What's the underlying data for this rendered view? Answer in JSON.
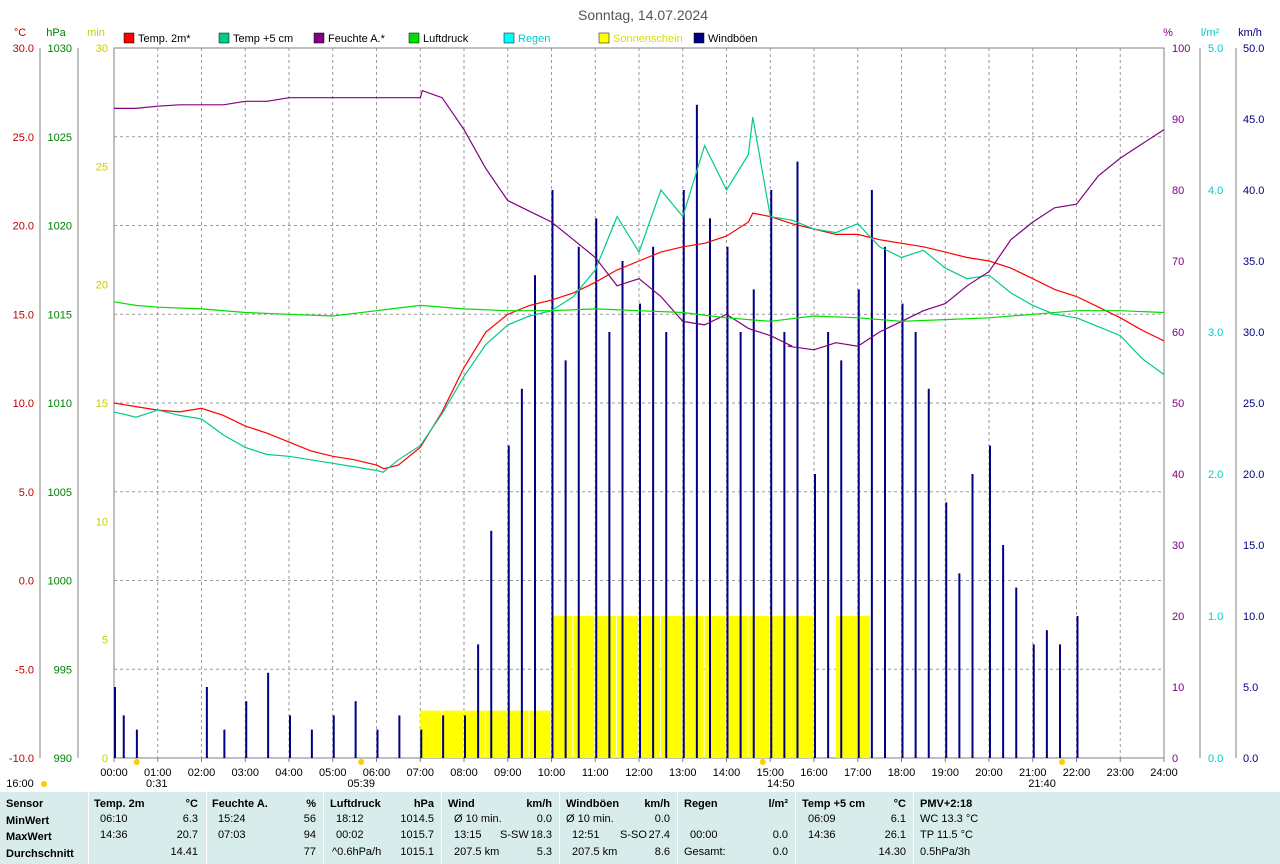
{
  "title": "Sonntag, 14.07.2024",
  "chart_data": {
    "type": "line",
    "title": "Sonntag, 14.07.2024",
    "x_axis": {
      "label": "",
      "range_hours": [
        0,
        24
      ],
      "tick_labels": [
        "00:00",
        "01:00",
        "02:00",
        "03:00",
        "04:00",
        "05:00",
        "06:00",
        "07:00",
        "08:00",
        "09:00",
        "10:00",
        "11:00",
        "12:00",
        "13:00",
        "14:00",
        "15:00",
        "16:00",
        "17:00",
        "18:00",
        "19:00",
        "20:00",
        "21:00",
        "22:00",
        "23:00",
        "24:00"
      ],
      "markers": [
        {
          "label": "0:31",
          "hour": 0.52
        },
        {
          "label": "05:39",
          "hour": 5.65
        },
        {
          "label": "14:50",
          "hour": 14.83
        },
        {
          "label": "21:40",
          "hour": 21.67
        },
        {
          "label": "16:00",
          "hour": 16.0
        }
      ]
    },
    "y_axes": [
      {
        "unit": "°C",
        "range": [
          -10,
          30
        ],
        "ticks": [
          "30.0",
          "25.0",
          "20.0",
          "15.0",
          "10.0",
          "5.0",
          "0.0",
          "-5.0",
          "-10.0"
        ],
        "color": "#c00000"
      },
      {
        "unit": "hPa",
        "range": [
          990,
          1030
        ],
        "ticks": [
          "1030",
          "1025",
          "1020",
          "1015",
          "1010",
          "1005",
          "1000",
          "995",
          "990"
        ],
        "color": "#008000"
      },
      {
        "unit": "min",
        "range": [
          0,
          30
        ],
        "ticks": [
          "30",
          "25",
          "20",
          "15",
          "10",
          "5",
          "0"
        ],
        "color": "#cccc00"
      },
      {
        "unit": "%",
        "range": [
          0,
          100
        ],
        "ticks": [
          "100",
          "90",
          "80",
          "70",
          "60",
          "50",
          "40",
          "30",
          "20",
          "10",
          "0"
        ],
        "color": "#800080"
      },
      {
        "unit": "l/m²",
        "range": [
          0,
          5
        ],
        "ticks": [
          "5.0",
          "4.0",
          "3.0",
          "2.0",
          "1.0",
          "0.0"
        ],
        "color": "#00cccc"
      },
      {
        "unit": "km/h",
        "range": [
          0,
          50
        ],
        "ticks": [
          "50.0",
          "45.0",
          "40.0",
          "35.0",
          "30.0",
          "25.0",
          "20.0",
          "15.0",
          "10.0",
          "5.0",
          "0.0"
        ],
        "color": "#000080"
      }
    ],
    "grid": true,
    "legend_position": "top",
    "legend": [
      {
        "name": "Temp. 2m*",
        "color": "#ff0000"
      },
      {
        "name": "Temp +5 cm",
        "color": "#00cc88"
      },
      {
        "name": "Feuchte A.*",
        "color": "#800080"
      },
      {
        "name": "Luftdruck",
        "color": "#00dd00"
      },
      {
        "name": "Regen",
        "color": "#00ffff"
      },
      {
        "name": "Sonnenschein",
        "color": "#ffff00"
      },
      {
        "name": "Windböen",
        "color": "#000080"
      }
    ],
    "series": [
      {
        "name": "Temp. 2m*",
        "axis": "°C",
        "color": "#ff0000",
        "x": [
          0,
          0.5,
          1,
          1.5,
          2,
          2.5,
          3,
          3.5,
          4,
          4.5,
          5,
          5.5,
          6,
          6.17,
          6.5,
          7,
          7.5,
          8,
          8.5,
          9,
          9.5,
          10,
          10.5,
          11,
          11.5,
          12,
          12.5,
          13,
          13.5,
          14,
          14.5,
          14.6,
          15,
          15.5,
          16,
          16.5,
          17,
          17.5,
          18,
          18.5,
          19,
          19.5,
          20,
          20.5,
          21,
          21.5,
          22,
          22.5,
          23,
          23.5,
          24
        ],
        "y": [
          10.0,
          9.8,
          9.6,
          9.5,
          9.7,
          9.3,
          8.7,
          8.3,
          7.8,
          7.3,
          7.0,
          6.8,
          6.5,
          6.3,
          6.5,
          7.5,
          9.5,
          12.0,
          14.0,
          15.0,
          15.5,
          15.8,
          16.2,
          16.8,
          17.5,
          18.0,
          18.5,
          18.8,
          19.0,
          19.4,
          20.2,
          20.7,
          20.5,
          20.1,
          19.8,
          19.5,
          19.5,
          19.2,
          19.0,
          18.8,
          18.5,
          18.2,
          18.0,
          17.6,
          17.0,
          16.4,
          16.0,
          15.4,
          14.8,
          14.1,
          13.5
        ]
      },
      {
        "name": "Temp +5 cm",
        "axis": "°C",
        "color": "#00cc88",
        "x": [
          0,
          0.5,
          1,
          1.5,
          2,
          2.5,
          3,
          3.5,
          4,
          4.5,
          5,
          5.5,
          6,
          6.15,
          6.5,
          7,
          7.5,
          8,
          8.5,
          9,
          9.5,
          10,
          10.5,
          11,
          11.5,
          12,
          12.5,
          13,
          13.5,
          14,
          14.5,
          14.6,
          15,
          15.5,
          16,
          16.5,
          17,
          17.5,
          18,
          18.5,
          19,
          19.5,
          20,
          20.5,
          21,
          21.5,
          22,
          22.5,
          23,
          23.5,
          24
        ],
        "y": [
          9.5,
          9.2,
          9.6,
          9.3,
          9.1,
          8.2,
          7.5,
          7.1,
          7.0,
          6.8,
          6.6,
          6.4,
          6.2,
          6.1,
          6.8,
          7.6,
          9.4,
          11.5,
          13.3,
          14.4,
          14.9,
          15.2,
          16.0,
          17.5,
          20.5,
          18.5,
          22.0,
          20.5,
          24.5,
          22.0,
          24.0,
          26.1,
          20.5,
          20.3,
          19.8,
          19.6,
          20.1,
          18.8,
          18.2,
          18.6,
          17.6,
          17.0,
          17.2,
          16.2,
          15.5,
          15.0,
          14.8,
          14.3,
          13.8,
          12.5,
          11.6
        ]
      },
      {
        "name": "Feuchte A.*",
        "axis": "%",
        "color": "#800080",
        "x": [
          0,
          0.5,
          1,
          1.5,
          2,
          2.5,
          3,
          3.5,
          4,
          4.5,
          5,
          5.5,
          6,
          6.5,
          7,
          7.05,
          7.5,
          8,
          8.5,
          9,
          9.5,
          10,
          10.5,
          11,
          11.5,
          12,
          12.5,
          13,
          13.5,
          14,
          14.5,
          15,
          15.5,
          15.4,
          16,
          16.5,
          17,
          17.5,
          18,
          18.5,
          19,
          19.5,
          20,
          20.5,
          21,
          21.5,
          22,
          22.5,
          23,
          23.5,
          24
        ],
        "y": [
          91.5,
          91.5,
          91.8,
          92,
          92,
          92,
          92.5,
          92.5,
          93,
          93,
          93,
          93,
          93,
          93,
          93,
          94,
          93,
          88.5,
          83,
          78.5,
          77,
          75.5,
          73,
          70.5,
          66.5,
          67.5,
          65,
          61.5,
          61,
          62.5,
          60.5,
          59.5,
          58,
          58,
          57.5,
          58.5,
          58,
          60,
          61.5,
          63,
          64,
          66.5,
          68.5,
          73,
          75.5,
          77.5,
          78,
          82,
          84.5,
          86.5,
          88.5
        ]
      },
      {
        "name": "Luftdruck",
        "axis": "hPa",
        "color": "#00dd00",
        "x": [
          0,
          0.5,
          1,
          2,
          3,
          4,
          5,
          6,
          7,
          8,
          9,
          10,
          11,
          12,
          13,
          14,
          15,
          16,
          17,
          18,
          19,
          20,
          21,
          22,
          23,
          24
        ],
        "y": [
          1015.7,
          1015.5,
          1015.4,
          1015.3,
          1015.1,
          1015.0,
          1014.9,
          1015.2,
          1015.5,
          1015.3,
          1015.2,
          1015.2,
          1015.3,
          1015.2,
          1015.1,
          1014.8,
          1014.6,
          1014.9,
          1014.8,
          1014.6,
          1014.7,
          1014.8,
          1015.0,
          1015.2,
          1015.2,
          1015.1
        ]
      }
    ],
    "bars": [
      {
        "name": "Sonnenschein",
        "axis": "min",
        "color": "#ffff00",
        "x": [
          7.0,
          7.5,
          8.0,
          8.5,
          9.0,
          9.5,
          10.0,
          10.5,
          11.0,
          11.5,
          12.0,
          12.5,
          13.0,
          13.5,
          14.0,
          14.5,
          15.0,
          15.5,
          16.5,
          16.8
        ],
        "y": [
          2,
          2,
          2,
          2,
          2,
          2,
          6,
          6,
          6,
          6,
          6,
          6,
          6,
          6,
          6,
          6,
          6,
          6,
          6,
          6
        ]
      },
      {
        "name": "Windböen",
        "axis": "km/h",
        "color": "#000080",
        "x": [
          0,
          0.2,
          0.5,
          2.1,
          2.5,
          3,
          3.5,
          4,
          4.5,
          5,
          5.5,
          6,
          6.5,
          7,
          7.5,
          8,
          8.3,
          8.6,
          9,
          9.3,
          9.6,
          10,
          10.3,
          10.6,
          11,
          11.3,
          11.6,
          12,
          12.3,
          12.6,
          13,
          13.3,
          13.6,
          14,
          14.3,
          14.6,
          15,
          15.3,
          15.6,
          16,
          16.3,
          16.6,
          17,
          17.3,
          17.6,
          18,
          18.3,
          18.6,
          19,
          19.3,
          19.6,
          20,
          20.3,
          20.6,
          21,
          21.3,
          21.6,
          22
        ],
        "y": [
          5,
          3,
          2,
          5,
          2,
          4,
          6,
          3,
          2,
          3,
          4,
          2,
          3,
          2,
          3,
          3,
          8,
          16,
          22,
          26,
          34,
          40,
          28,
          36,
          38,
          30,
          35,
          32,
          36,
          30,
          40,
          46,
          38,
          36,
          30,
          33,
          40,
          30,
          42,
          20,
          30,
          28,
          33,
          40,
          36,
          32,
          30,
          26,
          18,
          13,
          20,
          22,
          15,
          12,
          8,
          9,
          8,
          10
        ]
      }
    ],
    "regen_total": "0.0"
  },
  "stats": {
    "sensor_header": "Sensor",
    "min_label": "MinWert",
    "max_label": "MaxWert",
    "avg_label": "Durchschnitt",
    "temp2m": {
      "header": "Temp. 2m",
      "unit": "°C",
      "min_time": "06:10",
      "min": "6.3",
      "max_time": "14:36",
      "max": "20.7",
      "avg": "14.41"
    },
    "feuchte": {
      "header": "Feuchte A.",
      "unit": "%",
      "min_time": "15:24",
      "min": "56",
      "max_time": "07:03",
      "max": "94",
      "avg": "77"
    },
    "luftdruck": {
      "header": "Luftdruck",
      "unit": "hPa",
      "min_time": "18:12",
      "min": "1014.5",
      "max_time": "00:02",
      "max": "1015.7",
      "avg_label": "^0.6hPa/h",
      "avg": "1015.1"
    },
    "wind": {
      "header": "Wind",
      "unit": "km/h",
      "min_label": "Ø 10 min.",
      "min": "0.0",
      "max_time": "13:15",
      "max_dir": "S-SW",
      "max": "18.3",
      "avg_label": "207.5 km",
      "avg": "5.3"
    },
    "windboeen": {
      "header": "Windböen",
      "unit": "km/h",
      "min_label": "Ø 10 min.",
      "min": "0.0",
      "max_time": "12:51",
      "max_dir": "S-SO",
      "max": "27.4",
      "avg_label": "207.5 km",
      "avg": "8.6"
    },
    "regen": {
      "header": "Regen",
      "unit": "l/m²",
      "max_time": "00:00",
      "max": "0.0",
      "avg_label": "Gesamt:",
      "avg": "0.0"
    },
    "temp5cm": {
      "header": "Temp +5 cm",
      "unit": "°C",
      "min_time": "06:09",
      "min": "6.1",
      "max_time": "14:36",
      "max": "26.1",
      "avg": "14.30"
    },
    "pmv": {
      "header": "PMV+2:18",
      "min": "WC 13.3 °C",
      "max": "TP 11.5 °C",
      "avg": "0.5hPa/3h"
    }
  }
}
